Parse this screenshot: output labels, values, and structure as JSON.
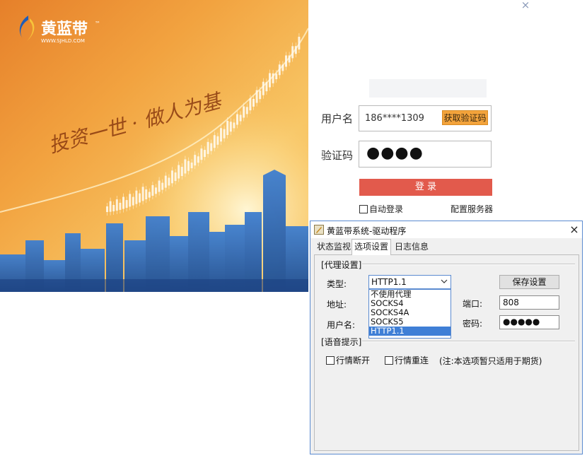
{
  "login": {
    "brand_name": "黄蓝带",
    "brand_tm": "™",
    "brand_url": "WWW.SJHLD.COM",
    "slogan": "投资一世 · 做人为基",
    "close_glyph": "×",
    "username_label": "用户名",
    "username_value": "186****1309",
    "get_code_label": "获取验证码",
    "code_label": "验证码",
    "code_value": "●●●●",
    "login_button": "登 录",
    "auto_login": "自动登录",
    "server_config": "配置服务器",
    "colors": {
      "login_button": "#e25a4c",
      "get_code": "#f3a33b"
    }
  },
  "dialog": {
    "title": "黄蓝带系统-驱动程序",
    "close_glyph": "×",
    "tabs": [
      "状态监视",
      "选项设置",
      "日志信息"
    ],
    "active_tab": "选项设置",
    "proxy_group": "[代理设置]",
    "type_label": "类型:",
    "type_value": "HTTP1.1",
    "type_options": [
      "不使用代理",
      "SOCKS4",
      "SOCKS4A",
      "SOCKS5",
      "HTTP1.1"
    ],
    "address_label": "地址:",
    "username_label": "用户名:",
    "save_button": "保存设置",
    "port_label": "端口:",
    "port_value": "808",
    "password_label": "密码:",
    "password_value": "●●●●●",
    "voice_group": "[语音提示]",
    "disconnect_label": "行情断开",
    "reconnect_label": "行情重连",
    "note": "(注:本选项暂只适用于期货)"
  }
}
